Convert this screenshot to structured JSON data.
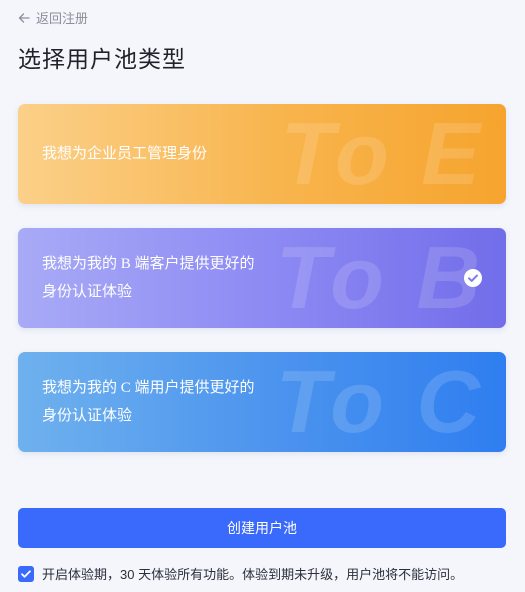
{
  "nav": {
    "back_label": "返回注册"
  },
  "page": {
    "title": "选择用户池类型"
  },
  "cards": [
    {
      "line1": "我想为企业员工管理身份",
      "line2": "",
      "bg_text": "To E",
      "selected": false
    },
    {
      "line1": "我想为我的 B 端客户提供更好的",
      "line2": "身份认证体验",
      "bg_text": "To B",
      "selected": true
    },
    {
      "line1": "我想为我的 C 端用户提供更好的",
      "line2": "身份认证体验",
      "bg_text": "To C",
      "selected": false
    }
  ],
  "actions": {
    "create_label": "创建用户池"
  },
  "trial": {
    "checked": true,
    "text": "开启体验期，30 天体验所有功能。体验到期未升级，用户池将不能访问。"
  },
  "colors": {
    "accent": "#3a6afc",
    "card_e": "#f8b44c",
    "card_b": "#8b88f3",
    "card_c": "#4d95ee"
  }
}
